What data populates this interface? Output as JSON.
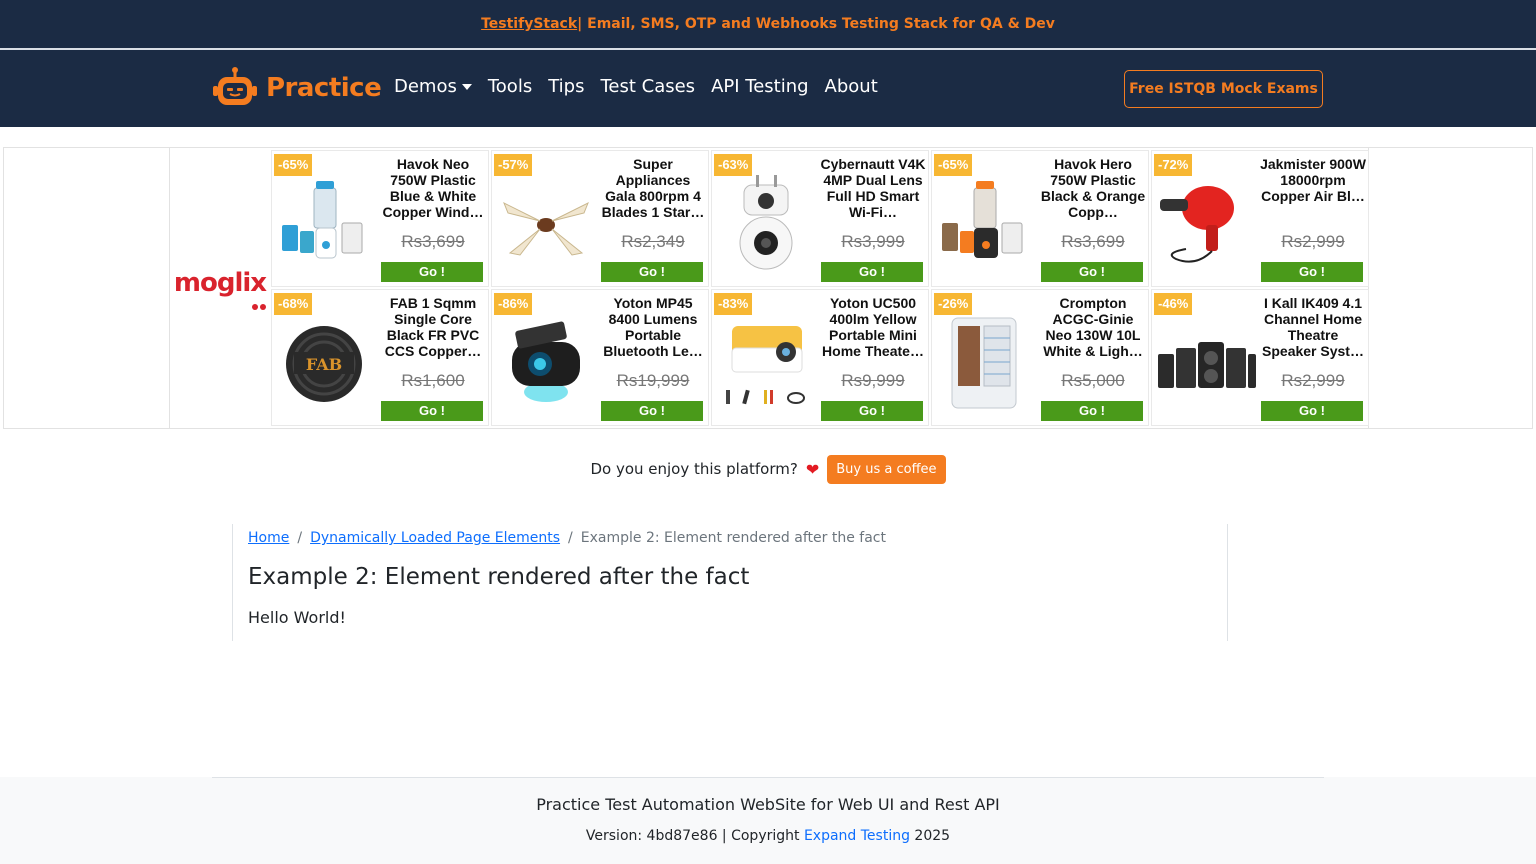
{
  "promo": {
    "link": "TestifyStack",
    "text": " | Email, SMS, OTP and Webhooks Testing Stack for QA & Dev"
  },
  "navbar": {
    "brand": "Practice",
    "items": [
      {
        "label": "Demos",
        "dropdown": true
      },
      {
        "label": "Tools"
      },
      {
        "label": "Tips"
      },
      {
        "label": "Test Cases"
      },
      {
        "label": "API Testing"
      },
      {
        "label": "About"
      }
    ],
    "cta": "Free ISTQB Mock Exams"
  },
  "ad": {
    "advertiser": "moglix",
    "close": "✕",
    "products": [
      {
        "discount": "-65%",
        "name": "Havok Neo 750W Plastic Blue & White Copper Wind…",
        "price": "Rs3,699",
        "cta": "Go !",
        "icon": "mixer-grinder-blue"
      },
      {
        "discount": "-57%",
        "name": "Super Appliances Gala 800rpm 4 Blades 1 Star…",
        "price": "Rs2,349",
        "cta": "Go !",
        "icon": "ceiling-fan"
      },
      {
        "discount": "-63%",
        "name": "Cybernautt V4K 4MP Dual Lens Full HD Smart Wi-Fi…",
        "price": "Rs3,999",
        "cta": "Go !",
        "icon": "security-camera"
      },
      {
        "discount": "-65%",
        "name": "Havok Hero 750W Plastic Black & Orange Copp…",
        "price": "Rs3,699",
        "cta": "Go !",
        "icon": "mixer-grinder-orange"
      },
      {
        "discount": "-72%",
        "name": "Jakmister 900W 18000rpm Copper Air Bl…",
        "price": "Rs2,999",
        "cta": "Go !",
        "icon": "air-blower"
      },
      {
        "discount": "-68%",
        "name": "FAB 1 Sqmm Single Core Black FR PVC CCS Copper…",
        "price": "Rs1,600",
        "cta": "Go !",
        "icon": "wire-coil"
      },
      {
        "discount": "-86%",
        "name": "Yoton MP45 8400 Lumens Portable Bluetooth Le…",
        "price": "Rs19,999",
        "cta": "Go !",
        "icon": "projector"
      },
      {
        "discount": "-83%",
        "name": "Yoton UC500 400lm Yellow Portable Mini Home Theate…",
        "price": "Rs9,999",
        "cta": "Go !",
        "icon": "mini-projector"
      },
      {
        "discount": "-26%",
        "name": "Crompton ACGC-Ginie Neo 130W 10L White & Ligh…",
        "price": "Rs5,000",
        "cta": "Go !",
        "icon": "air-cooler"
      },
      {
        "discount": "-46%",
        "name": "I Kall IK409 4.1 Channel Home Theatre Speaker Syst…",
        "price": "Rs2,999",
        "cta": "Go !",
        "icon": "speaker-system"
      }
    ]
  },
  "coffee": {
    "question": "Do you enjoy this platform?",
    "heart": "❤",
    "button": "Buy us a coffee"
  },
  "breadcrumb": {
    "home": "Home",
    "parent": "Dynamically Loaded Page Elements",
    "current": "Example 2: Element rendered after the fact",
    "separator": "/"
  },
  "main": {
    "title": "Example 2: Element rendered after the fact",
    "message": "Hello World!"
  },
  "footer": {
    "title": "Practice Test Automation WebSite for Web UI and Rest API",
    "version_prefix": "Version: 4bd87e86 | Copyright ",
    "link": "Expand Testing",
    "year": " 2025"
  },
  "colors": {
    "navy": "#1b2b44",
    "accent": "#f47c20",
    "link": "#0d6efd",
    "go_green": "#4a9a1a",
    "discount_bg": "#f7b733"
  }
}
